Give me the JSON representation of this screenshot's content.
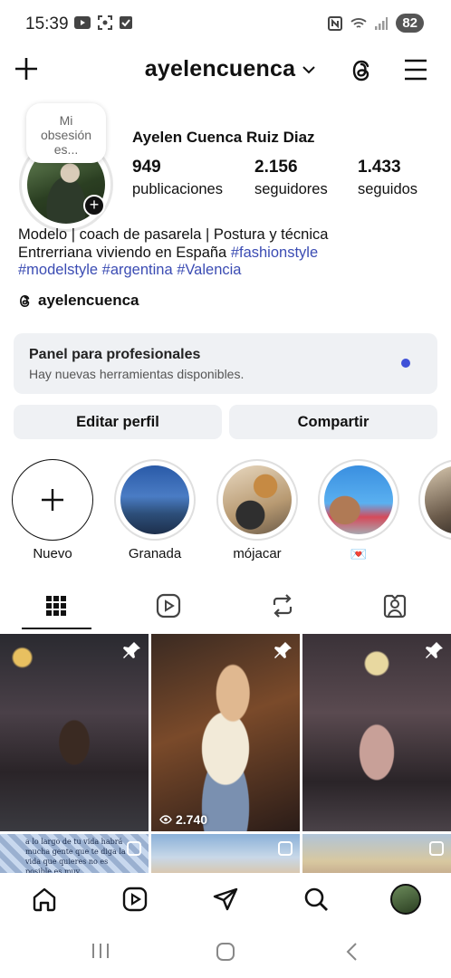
{
  "status_bar": {
    "time": "15:39",
    "battery": "82"
  },
  "header": {
    "username": "ayelencuenca"
  },
  "profile": {
    "note": "Mi obsesión es...",
    "full_name": "Ayelen Cuenca Ruiz Diaz",
    "stats": [
      {
        "value": "949",
        "label": "publicaciones"
      },
      {
        "value": "2.156",
        "label": "seguidores"
      },
      {
        "value": "1.433",
        "label": "seguidos"
      }
    ],
    "bio_line1": "Modelo | coach de pasarela | Postura y técnica",
    "bio_line2_text": "Entrerriana viviendo en España ",
    "bio_hashtags": [
      "#fashionstyle",
      "#modelstyle",
      "#argentina",
      "#Valencia"
    ],
    "threads_handle": "ayelencuenca"
  },
  "pro_panel": {
    "title": "Panel para profesionales",
    "subtitle": "Hay nuevas herramientas disponibles."
  },
  "buttons": {
    "edit": "Editar perfil",
    "share": "Compartir"
  },
  "highlights": [
    {
      "label": "Nuevo"
    },
    {
      "label": "Granada"
    },
    {
      "label": "mójacar"
    },
    {
      "label": "💌"
    },
    {
      "label": ""
    }
  ],
  "grid": {
    "views_post2": "2.740",
    "post5_text": "a lo largo de tu vida habrá mucha gente que te diga la vida que quieres no es posible es muy"
  },
  "colors": {
    "hashtag": "#3b4cb3",
    "accent_dot": "#3f51d8",
    "panel_bg": "#eff1f4"
  }
}
